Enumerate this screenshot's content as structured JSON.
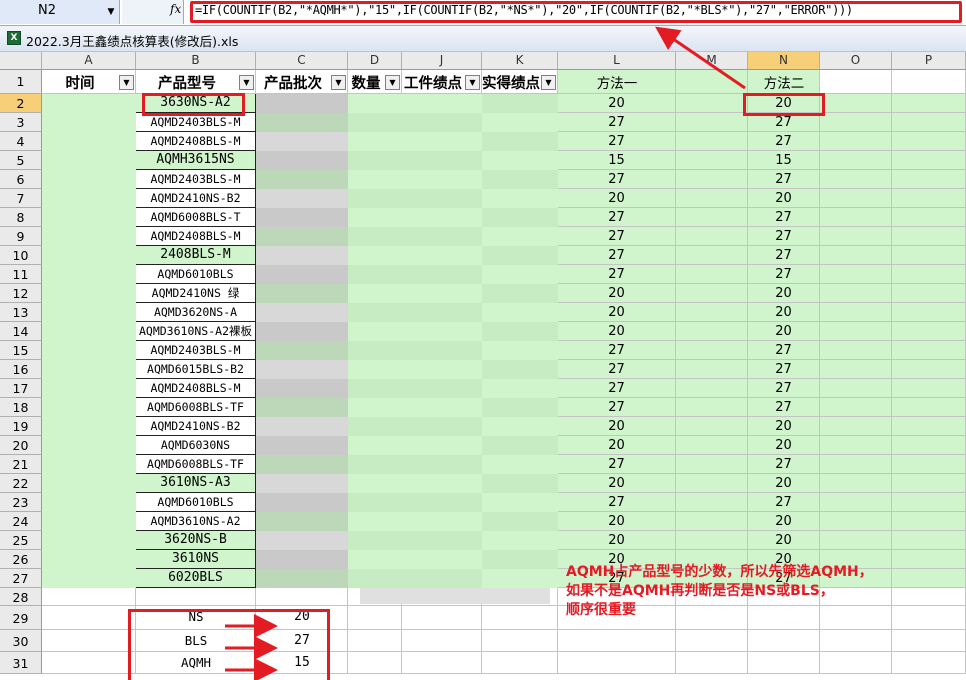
{
  "formula_bar": {
    "name_box": "N2",
    "fx_label": "fx",
    "formula": "=IF(COUNTIF(B2,\"*AQMH*\"),\"15\",IF(COUNTIF(B2,\"*NS*\"),\"20\",IF(COUNTIF(B2,\"*BLS*\"),\"27\",\"ERROR\")))"
  },
  "window": {
    "icon": "excel-file-icon",
    "title": "2022.3月王鑫绩点核算表(修改后).xls"
  },
  "columns": [
    "A",
    "B",
    "C",
    "D",
    "J",
    "K",
    "L",
    "M",
    "N",
    "O",
    "P"
  ],
  "selected_column": "N",
  "header_row": {
    "A": "时间",
    "B": "产品型号",
    "C": "产品批次",
    "D": "数量",
    "J": "工件绩点",
    "K": "实得绩点",
    "L": "方法一",
    "N": "方法二"
  },
  "rows": [
    {
      "n": "2",
      "model": "3630NS-A2",
      "l": "20",
      "nv": "20"
    },
    {
      "n": "3",
      "model": "AQMD2403BLS-M",
      "l": "27",
      "nv": "27"
    },
    {
      "n": "4",
      "model": "AQMD2408BLS-M",
      "l": "27",
      "nv": "27"
    },
    {
      "n": "5",
      "model": "AQMH3615NS",
      "l": "15",
      "nv": "15"
    },
    {
      "n": "6",
      "model": "AQMD2403BLS-M",
      "l": "27",
      "nv": "27"
    },
    {
      "n": "7",
      "model": "AQMD2410NS-B2",
      "l": "20",
      "nv": "20"
    },
    {
      "n": "8",
      "model": "AQMD6008BLS-T",
      "l": "27",
      "nv": "27"
    },
    {
      "n": "9",
      "model": "AQMD2408BLS-M",
      "l": "27",
      "nv": "27"
    },
    {
      "n": "10",
      "model": "2408BLS-M",
      "l": "27",
      "nv": "27"
    },
    {
      "n": "11",
      "model": "AQMD6010BLS",
      "l": "27",
      "nv": "27"
    },
    {
      "n": "12",
      "model": "AQMD2410NS 绿",
      "l": "20",
      "nv": "20"
    },
    {
      "n": "13",
      "model": "AQMD3620NS-A",
      "l": "20",
      "nv": "20"
    },
    {
      "n": "14",
      "model": "AQMD3610NS-A2裸板",
      "l": "20",
      "nv": "20"
    },
    {
      "n": "15",
      "model": "AQMD2403BLS-M",
      "l": "27",
      "nv": "27"
    },
    {
      "n": "16",
      "model": "AQMD6015BLS-B2",
      "l": "27",
      "nv": "27"
    },
    {
      "n": "17",
      "model": "AQMD2408BLS-M",
      "l": "27",
      "nv": "27"
    },
    {
      "n": "18",
      "model": "AQMD6008BLS-TF",
      "l": "27",
      "nv": "27"
    },
    {
      "n": "19",
      "model": "AQMD2410NS-B2",
      "l": "20",
      "nv": "20"
    },
    {
      "n": "20",
      "model": "AQMD6030NS",
      "l": "20",
      "nv": "20"
    },
    {
      "n": "21",
      "model": "AQMD6008BLS-TF",
      "l": "27",
      "nv": "27"
    },
    {
      "n": "22",
      "model": "3610NS-A3",
      "l": "20",
      "nv": "20"
    },
    {
      "n": "23",
      "model": "AQMD6010BLS",
      "l": "27",
      "nv": "27"
    },
    {
      "n": "24",
      "model": "AQMD3610NS-A2",
      "l": "20",
      "nv": "20"
    },
    {
      "n": "25",
      "model": "3620NS-B",
      "l": "20",
      "nv": "20"
    },
    {
      "n": "26",
      "model": "3610NS",
      "l": "20",
      "nv": "20"
    },
    {
      "n": "27",
      "model": "6020BLS",
      "l": "27",
      "nv": "27"
    }
  ],
  "extra_rows": [
    "28",
    "29",
    "30",
    "31"
  ],
  "lookup": [
    {
      "key": "NS",
      "value": "20"
    },
    {
      "key": "BLS",
      "value": "27"
    },
    {
      "key": "AQMH",
      "value": "15"
    }
  ],
  "annotation": [
    "AQMH占产品型号的少数，所以先筛选AQMH，",
    "如果不是AQMH再判断是否是NS或BLS，",
    "顺序很重要"
  ],
  "colors": {
    "highlight_green": "#d0f5cc",
    "annotation_red": "#e31b23",
    "selected_header": "#f7cf78"
  }
}
